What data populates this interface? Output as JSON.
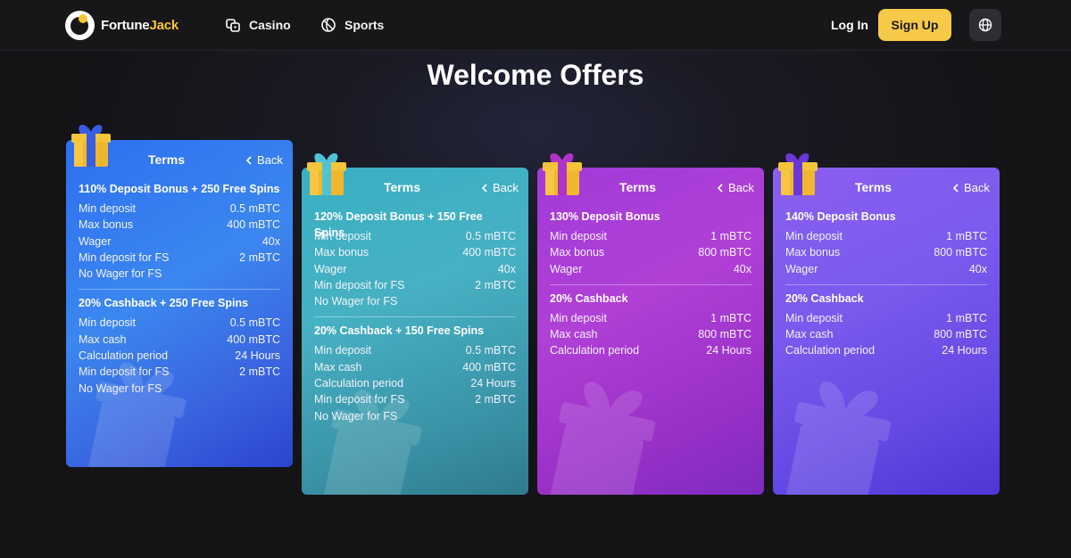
{
  "brand": {
    "name_a": "Fortune",
    "name_b": "Jack",
    "accent": "#f7c531"
  },
  "nav": {
    "casino": "Casino",
    "sports": "Sports"
  },
  "header": {
    "login": "Log In",
    "signup": "Sign Up",
    "signup_color": "#f7c948"
  },
  "page": {
    "title": "Welcome Offers"
  },
  "cards": [
    {
      "terms": "Terms",
      "back": "Back",
      "color": "#3b7ff0",
      "sections": [
        {
          "title": "110% Deposit Bonus + 250 Free Spins",
          "rows": [
            [
              "Min deposit",
              "0.5 mBTC"
            ],
            [
              "Max bonus",
              "400 mBTC"
            ],
            [
              "Wager",
              "40x"
            ],
            [
              "Min deposit for FS",
              "2 mBTC"
            ],
            [
              "No Wager for FS",
              ""
            ]
          ]
        },
        {
          "title": "20% Cashback + 250 Free Spins",
          "rows": [
            [
              "Min deposit",
              "0.5 mBTC"
            ],
            [
              "Max cash",
              "400 mBTC"
            ],
            [
              "Calculation period",
              "24 Hours"
            ],
            [
              "Min deposit for FS",
              "2 mBTC"
            ],
            [
              "No Wager for FS",
              ""
            ]
          ]
        }
      ]
    },
    {
      "terms": "Terms",
      "back": "Back",
      "color": "#3ab0c3",
      "sections": [
        {
          "title": "120% Deposit Bonus + 150 Free Spins",
          "rows": [
            [
              "Min deposit",
              "0.5 mBTC"
            ],
            [
              "Max bonus",
              "400 mBTC"
            ],
            [
              "Wager",
              "40x"
            ],
            [
              "Min deposit for FS",
              "2 mBTC"
            ],
            [
              "No Wager for FS",
              ""
            ]
          ]
        },
        {
          "title": "20% Cashback + 150 Free Spins",
          "rows": [
            [
              "Min deposit",
              "0.5 mBTC"
            ],
            [
              "Max cash",
              "400 mBTC"
            ],
            [
              "Calculation period",
              "24 Hours"
            ],
            [
              "Min deposit for FS",
              "2 mBTC"
            ],
            [
              "No Wager for FS",
              ""
            ]
          ]
        }
      ]
    },
    {
      "terms": "Terms",
      "back": "Back",
      "color": "#a23ad8",
      "sections": [
        {
          "title": "130% Deposit Bonus",
          "rows": [
            [
              "Min deposit",
              "1 mBTC"
            ],
            [
              "Max bonus",
              "800 mBTC"
            ],
            [
              "Wager",
              "40x"
            ]
          ]
        },
        {
          "title": "20% Cashback",
          "rows": [
            [
              "Min deposit",
              "1 mBTC"
            ],
            [
              "Max cash",
              "800 mBTC"
            ],
            [
              "Calculation period",
              "24 Hours"
            ]
          ]
        }
      ]
    },
    {
      "terms": "Terms",
      "back": "Back",
      "color": "#7a5aee",
      "sections": [
        {
          "title": "140% Deposit Bonus",
          "rows": [
            [
              "Min deposit",
              "1 mBTC"
            ],
            [
              "Max bonus",
              "800 mBTC"
            ],
            [
              "Wager",
              "40x"
            ]
          ]
        },
        {
          "title": "20% Cashback",
          "rows": [
            [
              "Min deposit",
              "1 mBTC"
            ],
            [
              "Max cash",
              "800 mBTC"
            ],
            [
              "Calculation period",
              "24 Hours"
            ]
          ]
        }
      ]
    }
  ]
}
